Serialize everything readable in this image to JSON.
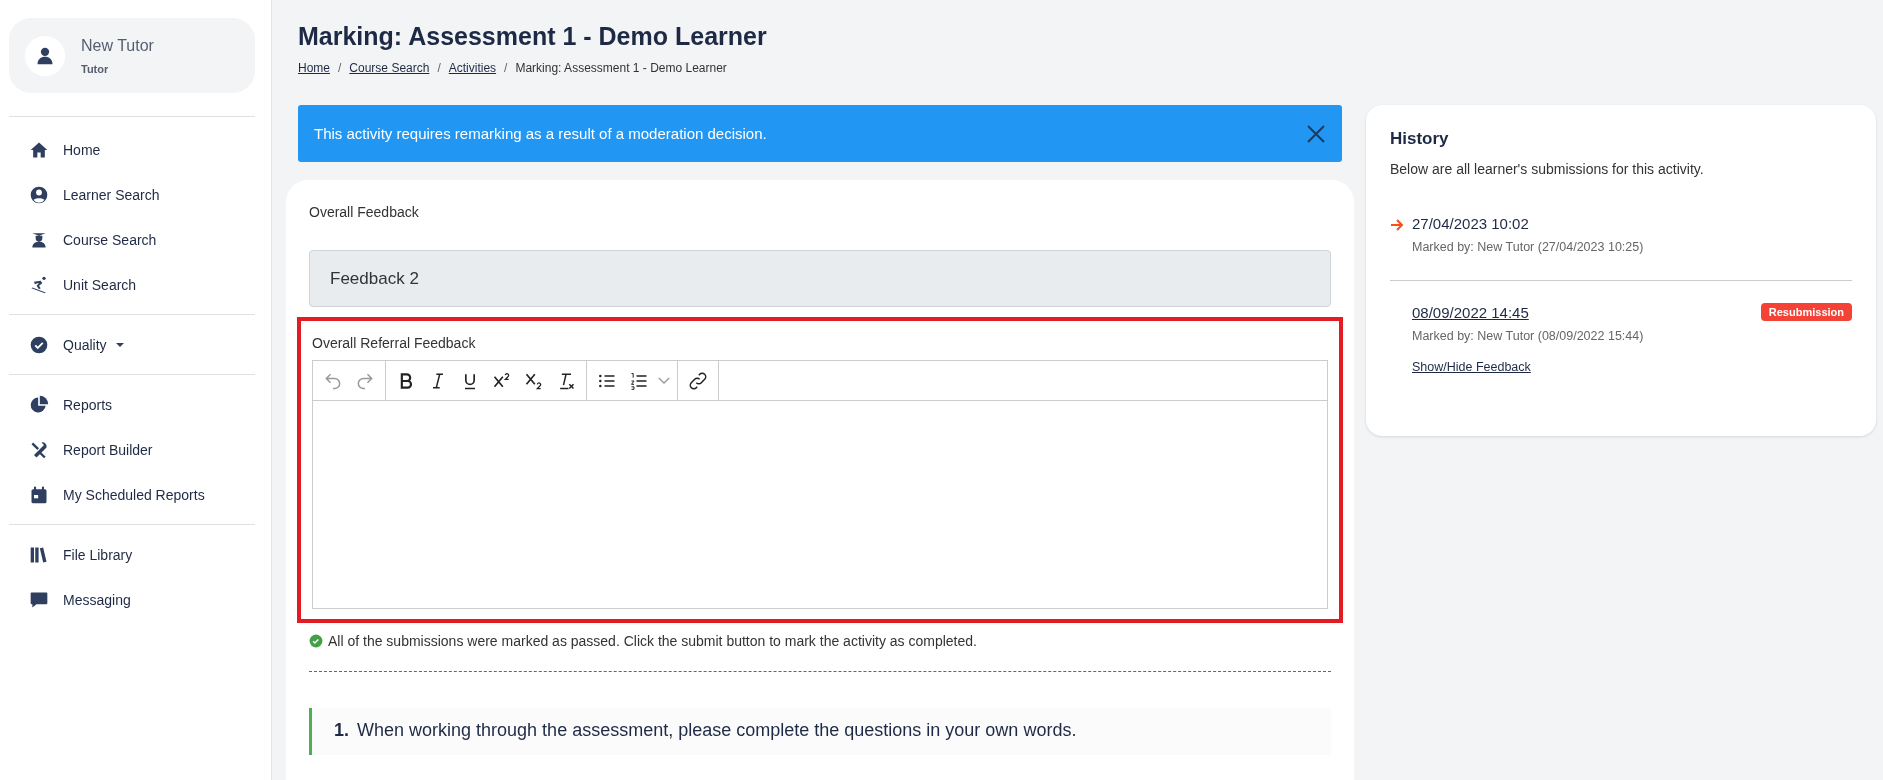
{
  "user": {
    "name": "New Tutor",
    "role": "Tutor"
  },
  "sidebar": {
    "groups": [
      {
        "items": [
          {
            "label": "Home",
            "kind": "home"
          },
          {
            "label": "Learner Search",
            "kind": "user-circle"
          },
          {
            "label": "Course Search",
            "kind": "graduate"
          },
          {
            "label": "Unit Search",
            "kind": "skier"
          }
        ]
      },
      {
        "items": [
          {
            "label": "Quality",
            "kind": "check-circle",
            "dropdown": true
          }
        ]
      },
      {
        "items": [
          {
            "label": "Reports",
            "kind": "pie"
          },
          {
            "label": "Report Builder",
            "kind": "tools"
          },
          {
            "label": "My Scheduled Reports",
            "kind": "calendar"
          }
        ]
      },
      {
        "items": [
          {
            "label": "File Library",
            "kind": "books"
          },
          {
            "label": "Messaging",
            "kind": "chat"
          }
        ]
      }
    ]
  },
  "page": {
    "title": "Marking: Assessment 1 - Demo Learner",
    "breadcrumb_separator": "/",
    "breadcrumbs": [
      {
        "label": "Home",
        "link": true
      },
      {
        "label": "Course Search",
        "link": true
      },
      {
        "label": "Activities",
        "link": true
      },
      {
        "label": "Marking: Assessment 1 - Demo Learner",
        "link": false
      }
    ]
  },
  "alert": {
    "text": "This activity requires remarking as a result of a moderation decision."
  },
  "marking": {
    "overall_feedback": {
      "label": "Overall Feedback",
      "value": "Feedback 2"
    },
    "referral_feedback": {
      "label": "Overall Referral Feedback",
      "highlighted": true,
      "toolbar": [
        {
          "tools": [
            {
              "kind": "undo",
              "disabled": true
            },
            {
              "kind": "redo",
              "disabled": true
            }
          ]
        },
        {
          "tools": [
            {
              "kind": "bold",
              "disabled": false
            },
            {
              "kind": "italic",
              "disabled": false
            },
            {
              "kind": "underline",
              "disabled": false
            },
            {
              "kind": "superscript",
              "disabled": false
            },
            {
              "kind": "subscript",
              "disabled": false
            },
            {
              "kind": "clear-format",
              "disabled": false
            }
          ]
        },
        {
          "tools": [
            {
              "kind": "bullet-list",
              "disabled": false
            },
            {
              "kind": "numbered-list",
              "disabled": false
            },
            {
              "kind": "dropdown",
              "disabled": false
            }
          ]
        },
        {
          "tools": [
            {
              "kind": "link",
              "disabled": false
            }
          ]
        }
      ]
    },
    "status": "All of the submissions were marked as passed. Click the submit button to mark the activity as completed.",
    "question": {
      "number": "1.",
      "text": "When working through the assessment, please complete the questions in your own words."
    }
  },
  "history": {
    "title": "History",
    "description": "Below are all learner's submissions for this activity.",
    "submissions": [
      {
        "date": "27/04/2023 10:02",
        "marked_by": "Marked by: New Tutor (27/04/2023 10:25)",
        "selected": true
      },
      {
        "date": "08/09/2022 14:45",
        "marked_by": "Marked by: New Tutor (08/09/2022 15:44)",
        "selected": false,
        "badge": "Resubmission",
        "toggle": "Show/Hide Feedback"
      }
    ]
  }
}
